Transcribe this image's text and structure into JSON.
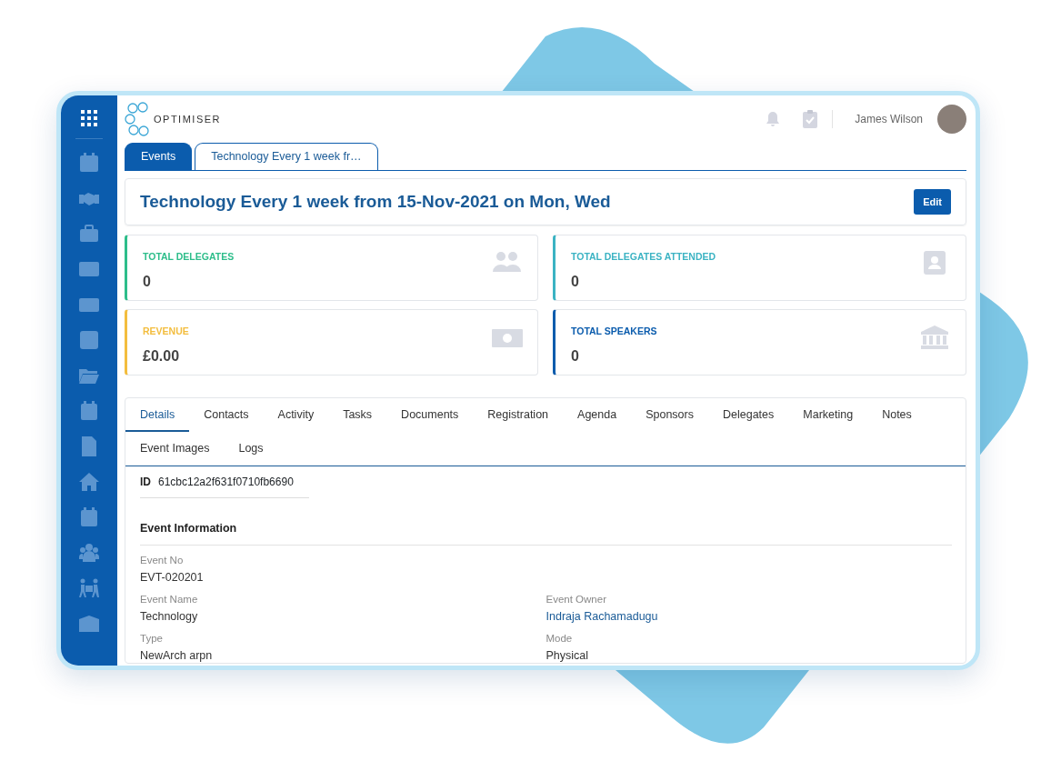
{
  "header": {
    "logo_text": "OPTIMISER",
    "user_name": "James Wilson"
  },
  "tabs": [
    {
      "label": "Events",
      "selected": true
    },
    {
      "label": "Technology Every 1 week fr…",
      "selected": false
    }
  ],
  "title": "Technology Every 1 week from 15-Nov-2021 on Mon, Wed",
  "edit_button": "Edit",
  "stats": [
    {
      "label": "TOTAL DELEGATES",
      "value": "0",
      "color": "#2dbd8a",
      "kind": "people"
    },
    {
      "label": "TOTAL DELEGATES ATTENDED",
      "value": "0",
      "color": "#3bb3c3",
      "kind": "contact"
    },
    {
      "label": "REVENUE",
      "value": "£0.00",
      "color": "#f3bd3e",
      "kind": "money"
    },
    {
      "label": "TOTAL SPEAKERS",
      "value": "0",
      "color": "#0b5cad",
      "kind": "bank"
    }
  ],
  "detail_tabs": [
    {
      "label": "Details",
      "selected": true
    },
    {
      "label": "Contacts",
      "selected": false
    },
    {
      "label": "Activity",
      "selected": false
    },
    {
      "label": "Tasks",
      "selected": false
    },
    {
      "label": "Documents",
      "selected": false
    },
    {
      "label": "Registration",
      "selected": false
    },
    {
      "label": "Agenda",
      "selected": false
    },
    {
      "label": "Sponsors",
      "selected": false
    },
    {
      "label": "Delegates",
      "selected": false
    },
    {
      "label": "Marketing",
      "selected": false
    },
    {
      "label": "Notes",
      "selected": false
    },
    {
      "label": "Event Images",
      "selected": false
    },
    {
      "label": "Logs",
      "selected": false
    }
  ],
  "record_id": {
    "label": "ID",
    "value": "61cbc12a2f631f0710fb6690"
  },
  "section_title": "Event Information",
  "field_rows": [
    [
      {
        "label": "Event No",
        "value": "EVT-020201",
        "link": false
      }
    ],
    [
      {
        "label": "Event Name",
        "value": "Technology",
        "link": false
      },
      {
        "label": "Event Owner",
        "value": "Indraja Rachamadugu",
        "link": true
      }
    ],
    [
      {
        "label": "Type",
        "value": "NewArch arpn",
        "link": false
      },
      {
        "label": "Mode",
        "value": "Physical",
        "link": false
      }
    ]
  ]
}
